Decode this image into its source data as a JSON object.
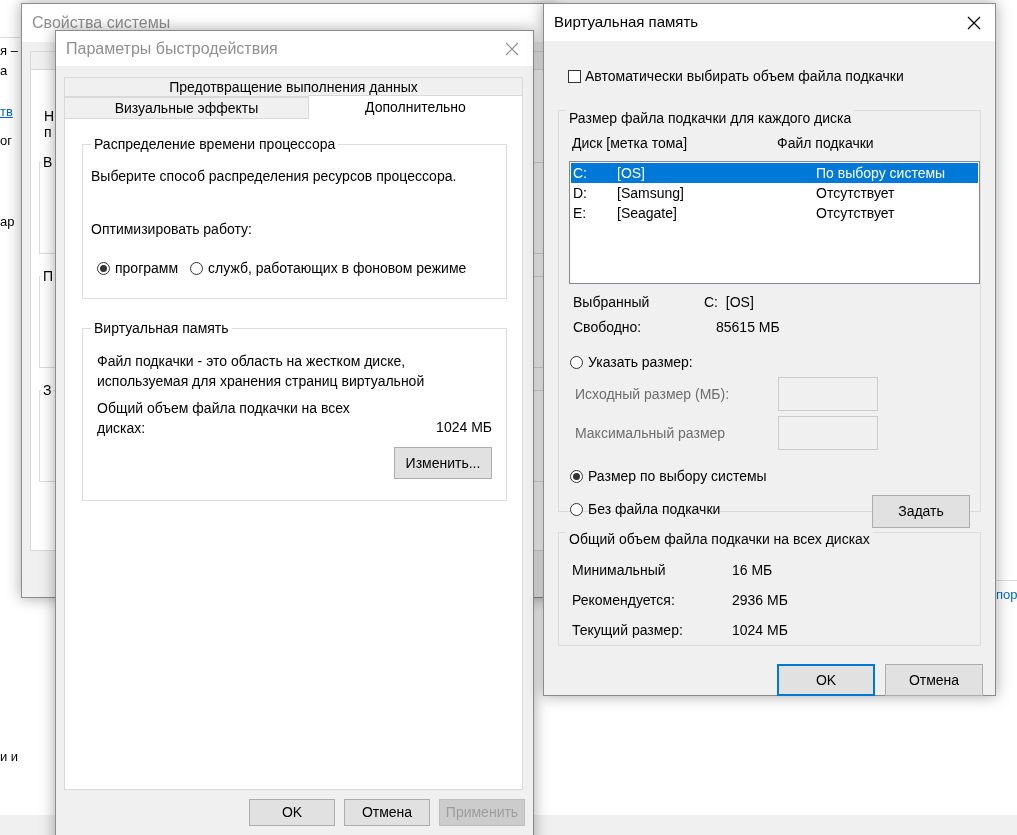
{
  "background": {
    "left_texts": [
      {
        "text": "я –",
        "link": false
      },
      {
        "text": "а",
        "link": false
      },
      {
        "text": "тв",
        "link": true
      },
      {
        "text": "ог",
        "link": false
      },
      {
        "text": "ар",
        "link": false
      },
      {
        "text": "и и",
        "link": false
      }
    ],
    "right_texts": [
      {
        "text": "пор",
        "link": true
      }
    ]
  },
  "system_properties": {
    "title": "Свойства системы",
    "text_fragments": [
      "Н",
      "п"
    ],
    "group_fragments": [
      "В",
      "П",
      "З"
    ]
  },
  "performance": {
    "title": "Параметры быстродействия",
    "tabs_back_row": [
      {
        "label": "Предотвращение выполнения данных",
        "selected": false
      }
    ],
    "tabs_front_row": [
      {
        "label": "Визуальные эффекты",
        "selected": false
      },
      {
        "label": "Дополнительно",
        "selected": true
      }
    ],
    "cpu_group": {
      "title": "Распределение времени процессора",
      "description": "Выберите способ распределения ресурсов процессора.",
      "optimize_label": "Оптимизировать работу:",
      "options": [
        {
          "label": "программ",
          "selected": true
        },
        {
          "label": "служб, работающих в фоновом режиме",
          "selected": false
        }
      ]
    },
    "vm_group": {
      "title": "Виртуальная память",
      "description": "Файл подкачки - это область на жестком диске, используемая для хранения страниц виртуальной",
      "total_label": "Общий объем файла подкачки на всех дисках:",
      "total_value": "1024 МБ",
      "change_button": "Изменить..."
    },
    "buttons": [
      {
        "label": "OK",
        "disabled": false
      },
      {
        "label": "Отмена",
        "disabled": false
      },
      {
        "label": "Применить",
        "disabled": true
      }
    ]
  },
  "virtual_memory": {
    "title": "Виртуальная память",
    "auto_manage": {
      "label": "Автоматически выбирать объем файла подкачки",
      "checked": false
    },
    "drives_group": {
      "title": "Размер файла подкачки для каждого диска",
      "columns": [
        "Диск [метка тома]",
        "Файл подкачки"
      ],
      "drives": [
        {
          "letter": "C:",
          "label": "[OS]",
          "paging": "По выбору системы",
          "selected": true
        },
        {
          "letter": "D:",
          "label": "[Samsung]",
          "paging": "Отсутствует",
          "selected": false
        },
        {
          "letter": "E:",
          "label": "[Seagate]",
          "paging": "Отсутствует",
          "selected": false
        }
      ],
      "selected_label": "Выбранный",
      "selected_value": "C:  [OS]",
      "free_label": "Свободно:",
      "free_value": "85615 МБ",
      "custom_size": {
        "label": "Указать размер:",
        "selected": false
      },
      "fields": [
        {
          "label": "Исходный размер (МБ):",
          "disabled": true
        },
        {
          "label": "Максимальный размер",
          "disabled": true
        }
      ],
      "other_options": [
        {
          "label": "Размер по выбору системы",
          "selected": true
        },
        {
          "label": "Без файла подкачки",
          "selected": false
        }
      ],
      "set_button": "Задать"
    },
    "total_group": {
      "title": "Общий объем файла подкачки на всех дисках",
      "rows": [
        {
          "label": "Минимальный",
          "value": "16 МБ"
        },
        {
          "label": "Рекомендуется:",
          "value": "2936 МБ"
        },
        {
          "label": "Текущий размер:",
          "value": "1024 МБ"
        }
      ]
    },
    "buttons": [
      {
        "label": "OK",
        "default": true
      },
      {
        "label": "Отмена",
        "default": false
      }
    ]
  }
}
